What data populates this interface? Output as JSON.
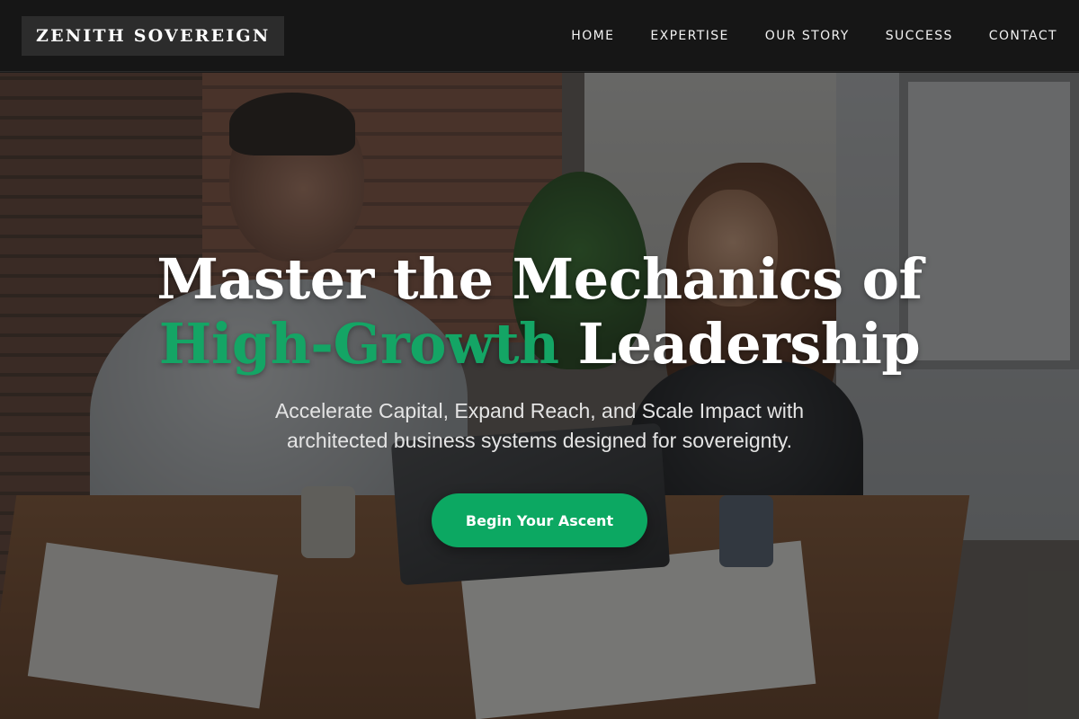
{
  "header": {
    "logo": "ZENITH SOVEREIGN",
    "nav": [
      {
        "label": "HOME"
      },
      {
        "label": "EXPERTISE"
      },
      {
        "label": "OUR STORY"
      },
      {
        "label": "SUCCESS"
      },
      {
        "label": "CONTACT"
      }
    ]
  },
  "hero": {
    "headline_line1": "Master the Mechanics of",
    "headline_accent": "High-Growth",
    "headline_rest": " Leadership",
    "subtext": "Accelerate Capital, Expand Reach, and Scale Impact with architected business systems designed for sovereignty.",
    "cta_label": "Begin Your Ascent"
  },
  "colors": {
    "accent": "#0ca862",
    "header_bg": "#161616"
  }
}
